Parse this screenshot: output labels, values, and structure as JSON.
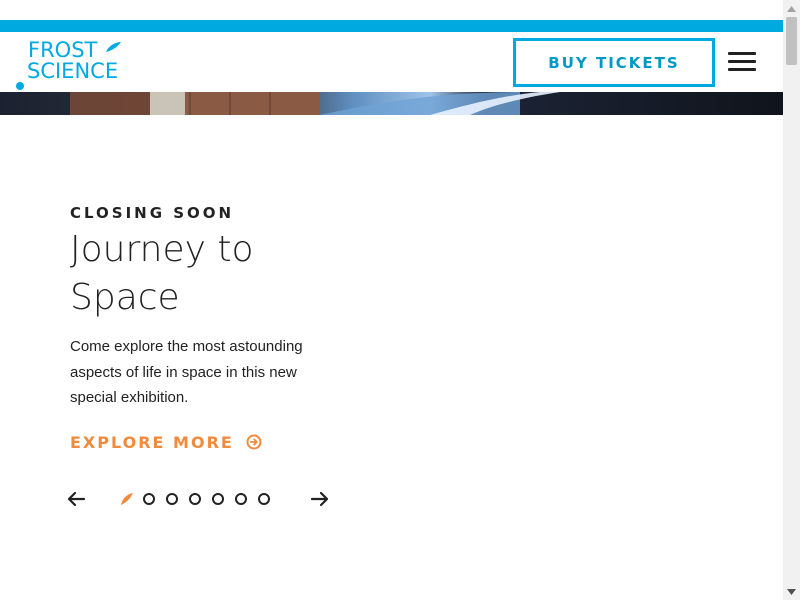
{
  "brand": {
    "logo_line1": "FROST",
    "logo_line2": "SCIENCE",
    "accent_blue": "#00a9e0",
    "accent_orange": "#f08a3c"
  },
  "header": {
    "buy_label": "BUY TICKETS",
    "menu_icon": "hamburger-menu-icon"
  },
  "hero": {
    "eyebrow": "CLOSING SOON",
    "title_line1": "Journey to",
    "title_line2": "Space",
    "description": "Come explore the most astounding aspects of life in space in this new special exhibition.",
    "cta_label": "EXPLORE MORE",
    "cta_icon": "arrow-circle-right-icon"
  },
  "carousel": {
    "prev_icon": "arrow-left-icon",
    "next_icon": "arrow-right-icon",
    "slide_count": 7,
    "active_slide": 1
  }
}
